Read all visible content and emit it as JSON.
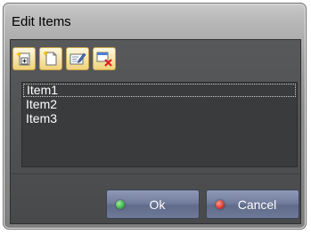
{
  "window": {
    "title": "Edit Items"
  },
  "toolbar": {
    "buttons": [
      {
        "icon": "add-item-icon"
      },
      {
        "icon": "new-document-icon"
      },
      {
        "icon": "edit-item-icon"
      },
      {
        "icon": "delete-item-icon"
      }
    ]
  },
  "list": {
    "items": [
      "Item1",
      "Item2",
      "Item3"
    ],
    "selected_index": 0
  },
  "buttons": {
    "ok_label": "Ok",
    "cancel_label": "Cancel"
  },
  "colors": {
    "ok_dot": "#3fb24a",
    "cancel_dot": "#d83a2f",
    "list_bg": "#3a3b3c",
    "panel_bg": "#545556",
    "button_bg": "#737e9e"
  }
}
